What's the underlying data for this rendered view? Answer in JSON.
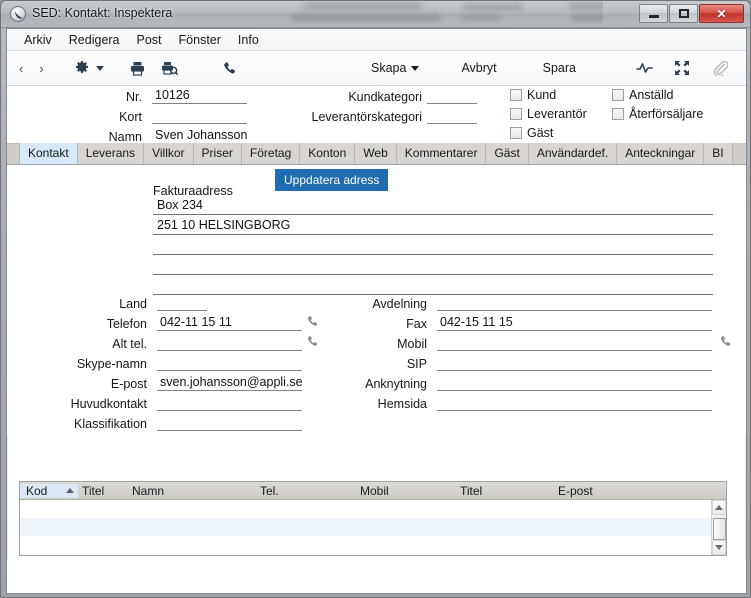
{
  "window": {
    "title": "SED: Kontakt: Inspektera",
    "app_icon": "app-circle-icon",
    "controls": {
      "minimize": "Minimize",
      "maximize": "Maximize",
      "close": "Close"
    }
  },
  "menubar": {
    "items": [
      {
        "label": "Arkiv"
      },
      {
        "label": "Redigera"
      },
      {
        "label": "Post"
      },
      {
        "label": "Fönster"
      },
      {
        "label": "Info"
      }
    ]
  },
  "toolbar": {
    "back": "‹",
    "forward": "›",
    "gear_icon": "gear-icon",
    "print_icon": "print-icon",
    "print_preview_icon": "print-preview-icon",
    "phone_icon": "phone-icon",
    "create_label": "Skapa",
    "cancel_label": "Avbryt",
    "save_label": "Spara",
    "activity_icon": "activity-icon",
    "expand_icon": "expand-icon",
    "attachment_icon": "paperclip-icon"
  },
  "header": {
    "fields": [
      {
        "label": "Nr.",
        "value": "10126"
      },
      {
        "label": "Kort",
        "value": ""
      },
      {
        "label": "Namn",
        "value": "Sven Johansson"
      },
      {
        "label": "Kundkategori",
        "value": ""
      },
      {
        "label": "Leverantörskategori",
        "value": ""
      }
    ],
    "checkboxes": [
      {
        "label": "Kund",
        "checked": false
      },
      {
        "label": "Leverantör",
        "checked": false
      },
      {
        "label": "Gäst",
        "checked": false
      },
      {
        "label": "Anställd",
        "checked": false
      },
      {
        "label": "Återförsäljare",
        "checked": false
      }
    ]
  },
  "tabs": [
    {
      "label": "Kontakt",
      "active": true
    },
    {
      "label": "Leverans",
      "active": false
    },
    {
      "label": "Villkor",
      "active": false
    },
    {
      "label": "Priser",
      "active": false
    },
    {
      "label": "Företag",
      "active": false
    },
    {
      "label": "Konton",
      "active": false
    },
    {
      "label": "Web",
      "active": false
    },
    {
      "label": "Kommentarer",
      "active": false
    },
    {
      "label": "Gäst",
      "active": false
    },
    {
      "label": "Användardef.",
      "active": false
    },
    {
      "label": "Anteckningar",
      "active": false
    },
    {
      "label": "BI",
      "active": false
    }
  ],
  "contact_tab": {
    "address_caption": "Fakturaadress",
    "update_address_button": "Uppdatera adress",
    "address_lines": [
      "Box 234",
      "251 10  HELSINGBORG",
      "",
      ""
    ],
    "left_fields": [
      {
        "label": "Land",
        "value": ""
      },
      {
        "label": "Telefon",
        "value": "042-11 15 11"
      },
      {
        "label": "Alt tel.",
        "value": ""
      },
      {
        "label": "Skype-namn",
        "value": ""
      },
      {
        "label": "E-post",
        "value": "sven.johansson@appli.se"
      },
      {
        "label": "Huvudkontakt",
        "value": ""
      },
      {
        "label": "Klassifikation",
        "value": ""
      }
    ],
    "right_fields": [
      {
        "label": "Avdelning",
        "value": ""
      },
      {
        "label": "Fax",
        "value": "042-15 11 15"
      },
      {
        "label": "Mobil",
        "value": ""
      },
      {
        "label": "SIP",
        "value": ""
      },
      {
        "label": "Anknytning",
        "value": ""
      },
      {
        "label": "Hemsida",
        "value": ""
      }
    ]
  },
  "grid": {
    "columns": [
      "Kod",
      "Titel",
      "Namn",
      "Tel.",
      "Mobil",
      "Titel",
      "E-post"
    ],
    "sorted_column": "Kod",
    "sort_direction": "asc",
    "rows": []
  },
  "colors": {
    "accent_button": "#1f6cb0",
    "active_tab": "#d7e9f9",
    "tab_strip": "#cfcdc8",
    "toolbar_icon": "#2c3e52",
    "close_button": "#c9352c"
  }
}
